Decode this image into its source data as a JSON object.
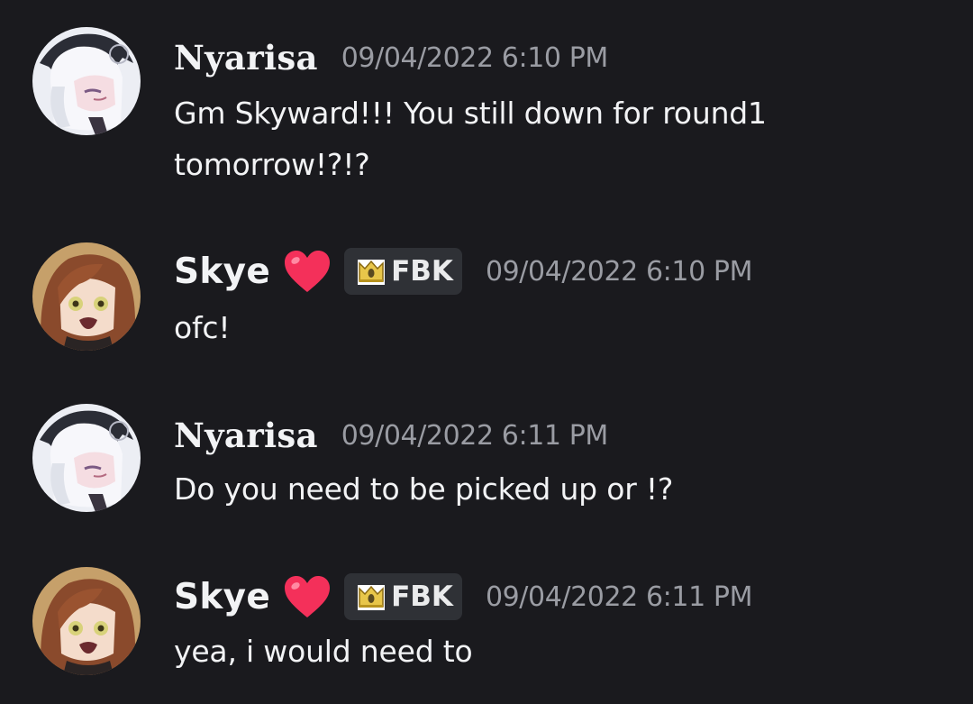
{
  "messages": [
    {
      "author": "Nyarisa",
      "timestamp": "09/04/2022 6:10 PM",
      "text": "Gm Skyward!!! You still down for round1 tomorrow!?!?"
    },
    {
      "author": "Skye",
      "emoji": "heart",
      "tag": "FBK",
      "timestamp": "09/04/2022 6:10 PM",
      "text": "ofc!"
    },
    {
      "author": "Nyarisa",
      "timestamp": "09/04/2022 6:11 PM",
      "text": "Do you need to be picked up or !?"
    },
    {
      "author": "Skye",
      "emoji": "heart",
      "tag": "FBK",
      "timestamp": "09/04/2022 6:11 PM",
      "text": "yea, i would need to"
    }
  ],
  "colors": {
    "background": "#1a1a1e",
    "text": "#f2f3f5",
    "timestamp": "#9a9ca3",
    "tag_bg": "#2f3136",
    "heart": "#f4305a"
  }
}
